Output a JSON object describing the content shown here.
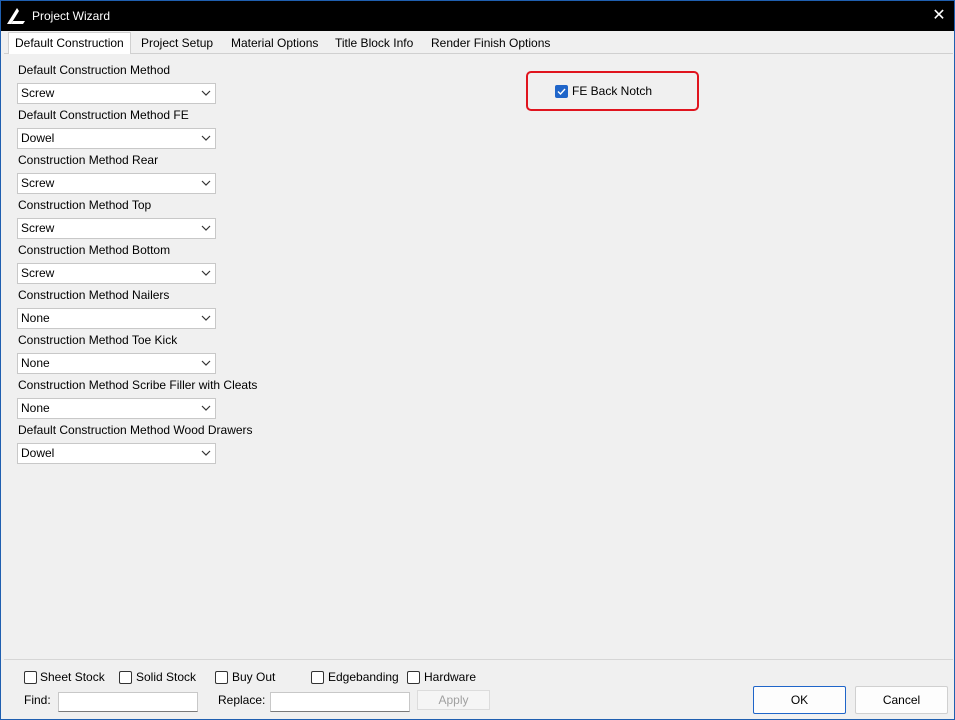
{
  "window": {
    "title": "Project Wizard",
    "close_icon": "close-icon"
  },
  "tabs": [
    {
      "label": "Default Construction",
      "active": true
    },
    {
      "label": "Project Setup",
      "active": false
    },
    {
      "label": "Material Options",
      "active": false
    },
    {
      "label": "Title Block Info",
      "active": false
    },
    {
      "label": "Render Finish Options",
      "active": false
    }
  ],
  "fields": [
    {
      "label": "Default Construction Method",
      "value": "Screw"
    },
    {
      "label": "Default Construction Method FE",
      "value": "Dowel"
    },
    {
      "label": "Construction Method Rear",
      "value": "Screw"
    },
    {
      "label": "Construction Method Top",
      "value": "Screw"
    },
    {
      "label": "Construction Method Bottom",
      "value": "Screw"
    },
    {
      "label": "Construction Method Nailers",
      "value": "None"
    },
    {
      "label": "Construction Method Toe Kick",
      "value": "None"
    },
    {
      "label": "Construction Method Scribe Filler with Cleats",
      "value": "None"
    },
    {
      "label": "Default Construction Method Wood Drawers",
      "value": "Dowel"
    }
  ],
  "fe_back_notch": {
    "label": "FE Back Notch",
    "checked": true
  },
  "filters": [
    {
      "label": "Sheet Stock",
      "checked": false
    },
    {
      "label": "Solid Stock",
      "checked": false
    },
    {
      "label": "Buy Out",
      "checked": false
    },
    {
      "label": "Edgebanding",
      "checked": false
    },
    {
      "label": "Hardware",
      "checked": false
    }
  ],
  "find": {
    "label": "Find:",
    "value": ""
  },
  "replace": {
    "label": "Replace:",
    "value": ""
  },
  "apply_label": "Apply",
  "ok_label": "OK",
  "cancel_label": "Cancel",
  "colors": {
    "accent": "#1f65c9",
    "highlight": "#e0141e",
    "titlebar": "#000000"
  }
}
